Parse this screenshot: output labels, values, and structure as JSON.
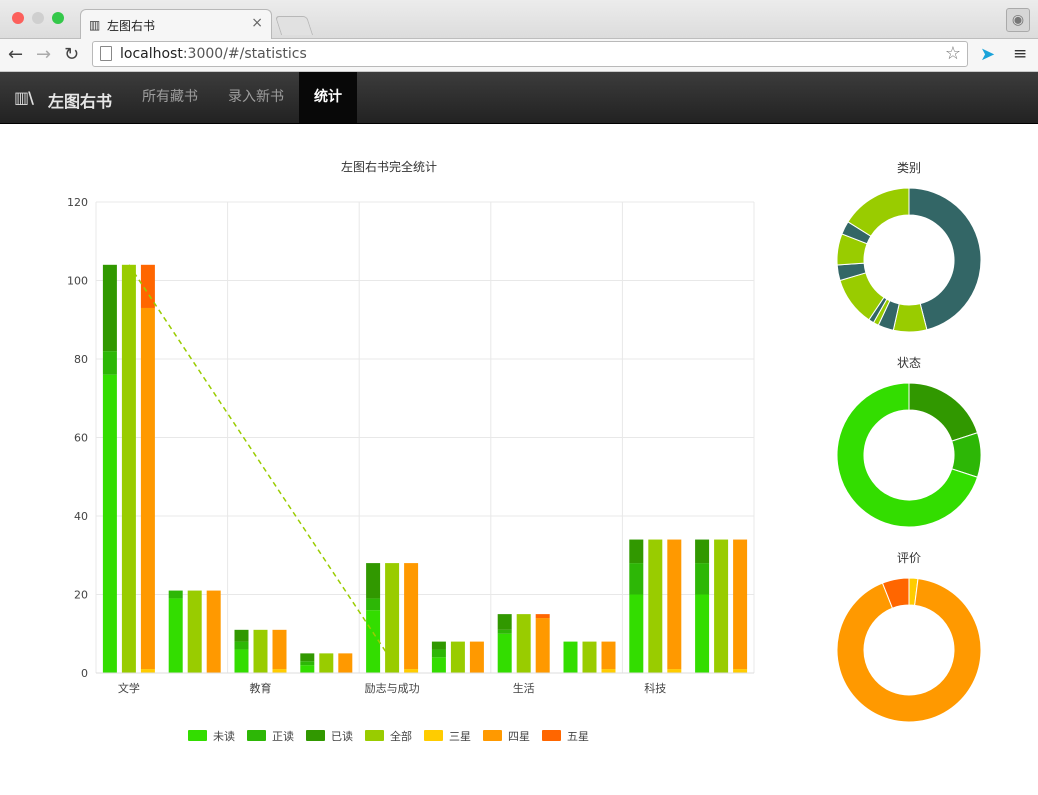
{
  "browser": {
    "tab_title": "左图右书",
    "url_host": "localhost",
    "url_rest": ":3000/#/statistics",
    "traffic_lights": [
      "#fc605c",
      "#fdbc40",
      "#34c84a"
    ]
  },
  "navbar": {
    "brand": "左图右书",
    "links": [
      "所有藏书",
      "录入新书",
      "统计"
    ],
    "active_index": 2
  },
  "chart_data": [
    {
      "type": "bar",
      "title": "左图右书完全统计",
      "categories": [
        "文学",
        "",
        "教育",
        "",
        "励志与成功",
        "",
        "生活",
        "",
        "科技",
        ""
      ],
      "ylim": [
        0,
        120
      ],
      "yticks": [
        0,
        20,
        40,
        60,
        80,
        100,
        120
      ],
      "grid": true,
      "legend_position": "bottom",
      "stacks": [
        {
          "name": "status",
          "segments": [
            "未读",
            "正读",
            "已读"
          ]
        },
        {
          "name": "all",
          "segments": [
            "全部"
          ]
        },
        {
          "name": "rating",
          "segments": [
            "三星",
            "四星",
            "五星"
          ]
        }
      ],
      "series": [
        {
          "name": "未读",
          "stack": "status",
          "color": "#33dd00",
          "values": [
            76,
            19,
            6,
            2,
            16,
            4,
            10,
            8,
            20,
            20
          ]
        },
        {
          "name": "正读",
          "stack": "status",
          "color": "#2db706",
          "values": [
            6,
            2,
            2,
            1,
            3,
            2,
            1,
            0,
            8,
            8
          ]
        },
        {
          "name": "已读",
          "stack": "status",
          "color": "#319800",
          "values": [
            22,
            0,
            3,
            2,
            9,
            2,
            4,
            0,
            6,
            6
          ]
        },
        {
          "name": "全部",
          "stack": "all",
          "color": "#99cc00",
          "values": [
            104,
            21,
            11,
            5,
            28,
            8,
            15,
            8,
            34,
            34
          ]
        },
        {
          "name": "三星",
          "stack": "rating",
          "color": "#ffcc00",
          "values": [
            1,
            0,
            1,
            0,
            1,
            0,
            0,
            1,
            1,
            1
          ]
        },
        {
          "name": "四星",
          "stack": "rating",
          "color": "#ff9900",
          "values": [
            92,
            21,
            10,
            5,
            27,
            8,
            14,
            7,
            33,
            33
          ]
        },
        {
          "name": "五星",
          "stack": "rating",
          "color": "#ff6600",
          "values": [
            11,
            0,
            0,
            0,
            0,
            0,
            1,
            0,
            0,
            0
          ]
        }
      ],
      "line": {
        "name": "全部",
        "color": "#99cc00",
        "dashed": true,
        "points": [
          [
            0,
            104
          ],
          [
            4,
            3
          ]
        ]
      }
    },
    {
      "type": "pie",
      "title": "类别",
      "donut": true,
      "slices": [
        {
          "value": 46.0,
          "color": "#336666"
        },
        {
          "value": 7.5,
          "color": "#99cc00"
        },
        {
          "value": 3.5,
          "color": "#336666"
        },
        {
          "value": 1.2,
          "color": "#99cc00"
        },
        {
          "value": 1.2,
          "color": "#336666"
        },
        {
          "value": 11.0,
          "color": "#99cc00"
        },
        {
          "value": 3.5,
          "color": "#336666"
        },
        {
          "value": 7.0,
          "color": "#99cc00"
        },
        {
          "value": 3.0,
          "color": "#336666"
        },
        {
          "value": 16.1,
          "color": "#99cc00"
        }
      ]
    },
    {
      "type": "pie",
      "title": "状态",
      "donut": true,
      "slices": [
        {
          "value": 20,
          "color": "#319800"
        },
        {
          "value": 10,
          "color": "#2db706"
        },
        {
          "value": 70,
          "color": "#33dd00"
        }
      ]
    },
    {
      "type": "pie",
      "title": "评价",
      "donut": true,
      "slices": [
        {
          "value": 2,
          "color": "#ffcc00"
        },
        {
          "value": 92,
          "color": "#ff9900"
        },
        {
          "value": 6,
          "color": "#ff6600"
        }
      ]
    }
  ]
}
